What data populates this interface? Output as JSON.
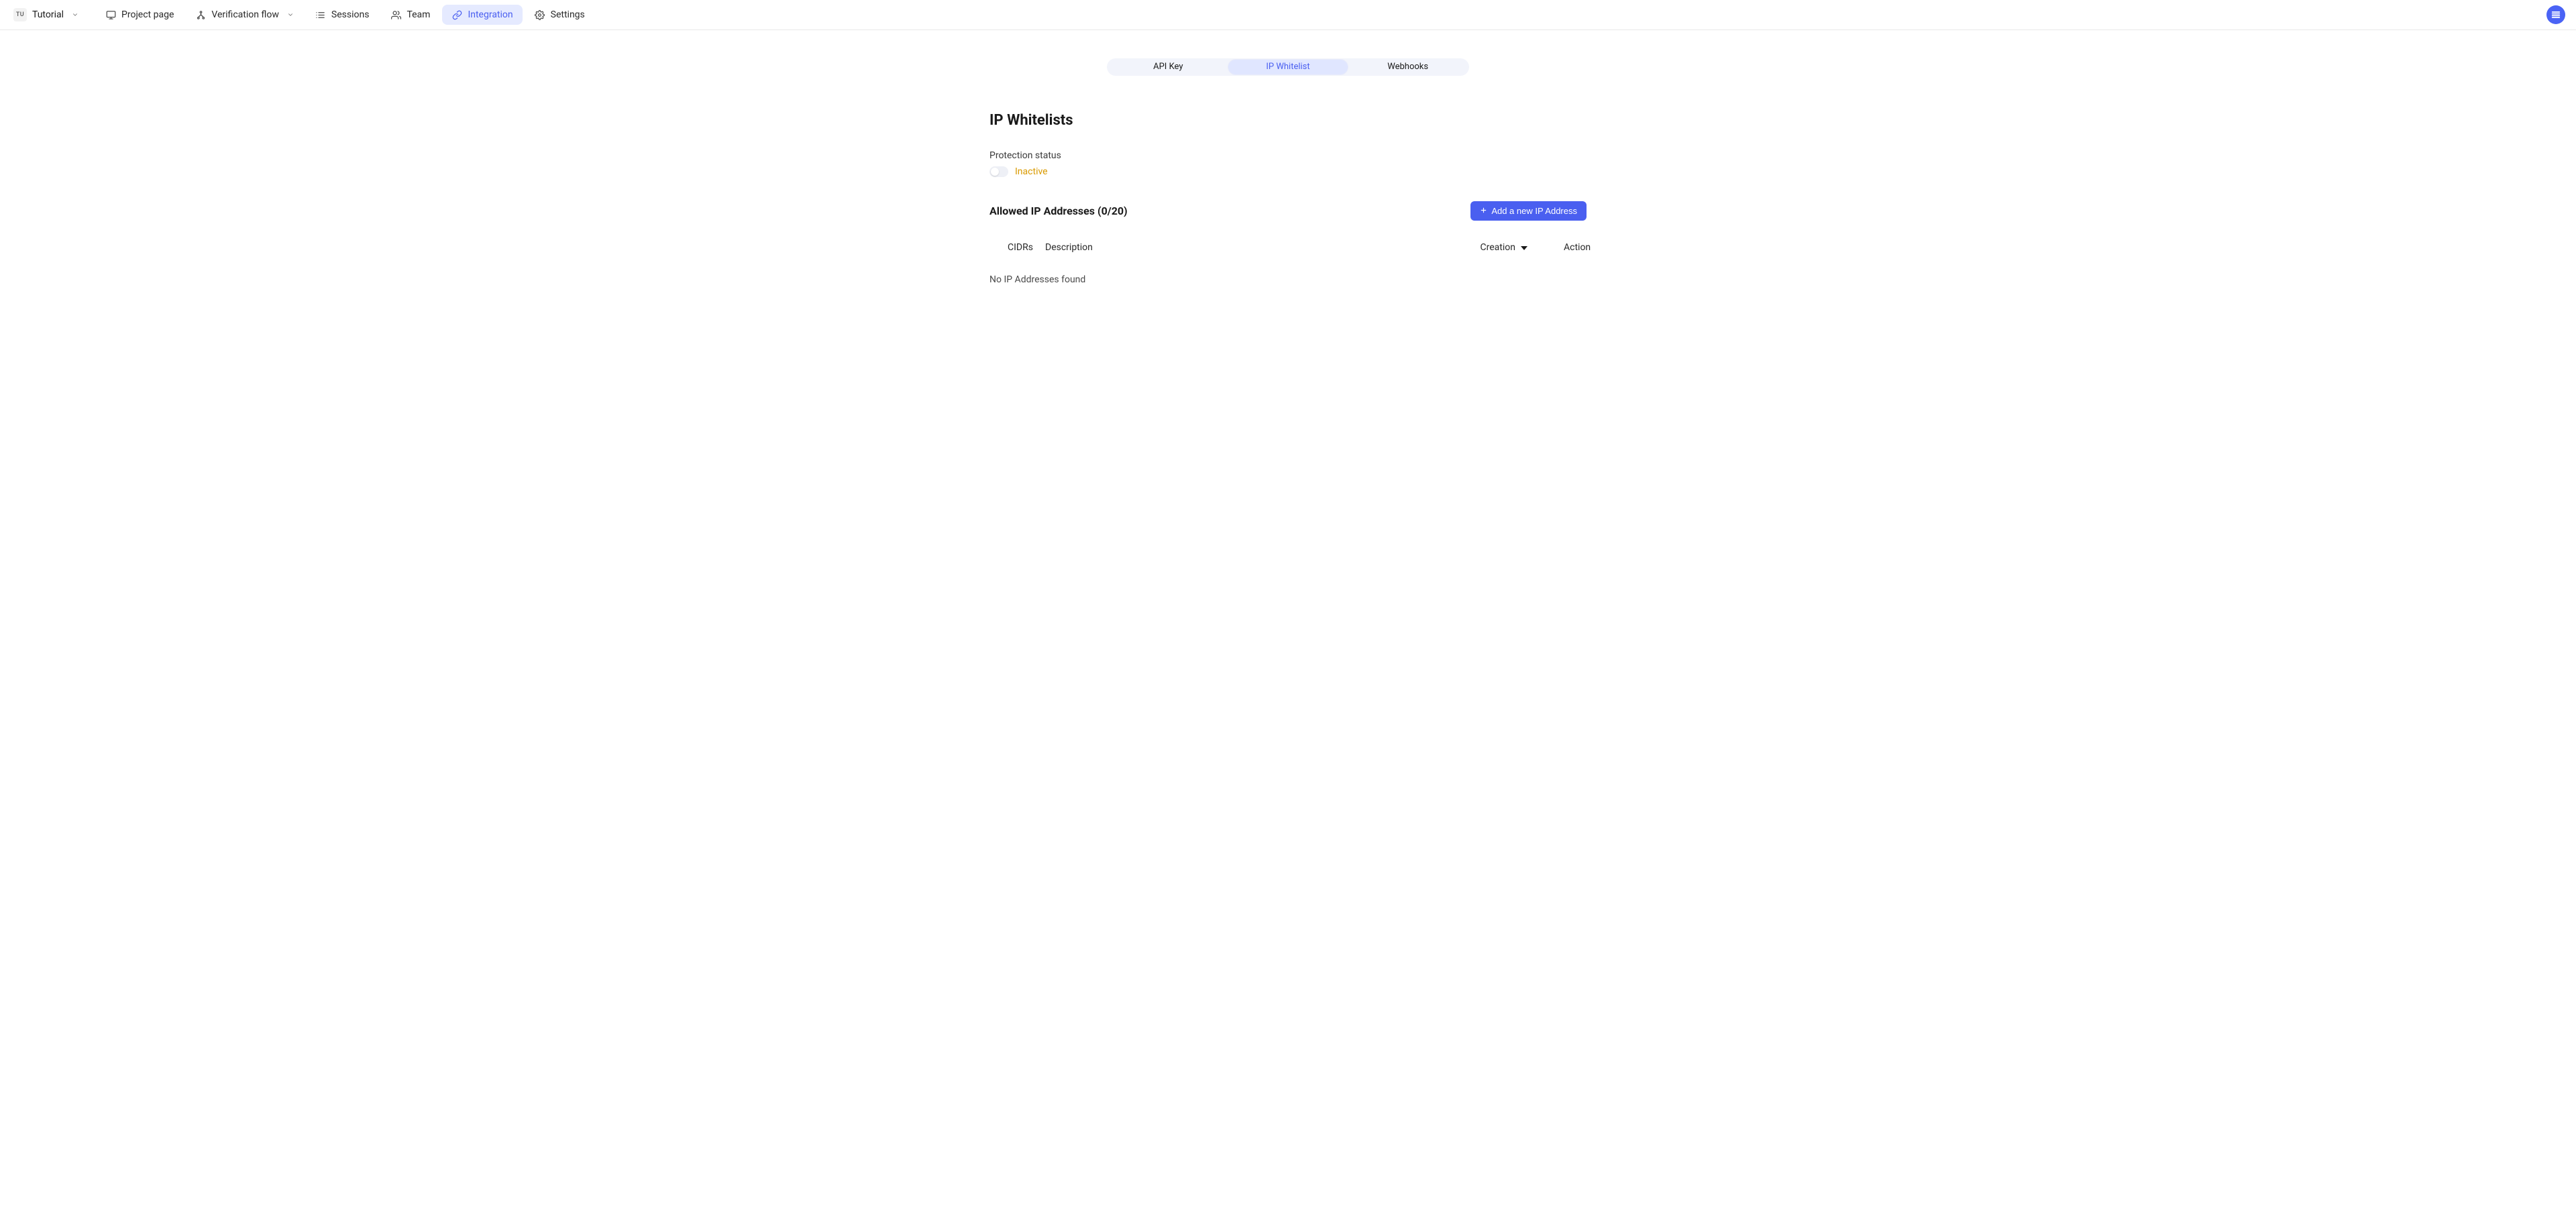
{
  "project": {
    "badge": "TU",
    "name": "Tutorial"
  },
  "nav": {
    "project_page": "Project page",
    "verification_flow": "Verification flow",
    "sessions": "Sessions",
    "team": "Team",
    "integration": "Integration",
    "settings": "Settings"
  },
  "tabs": {
    "api_key": "API Key",
    "ip_whitelist": "IP Whitelist",
    "webhooks": "Webhooks"
  },
  "page": {
    "title": "IP Whitelists",
    "status_label": "Protection status",
    "status_value": "Inactive",
    "allowed_title": "Allowed IP Addresses (0/20)",
    "add_button": "Add a new IP Address"
  },
  "table": {
    "col_cidrs": "CIDRs",
    "col_description": "Description",
    "col_creation": "Creation",
    "col_action": "Action",
    "empty": "No IP Addresses found"
  },
  "colors": {
    "accent": "#4a5ff0",
    "accent_bg": "#e5eaff",
    "warning": "#d99a00"
  }
}
